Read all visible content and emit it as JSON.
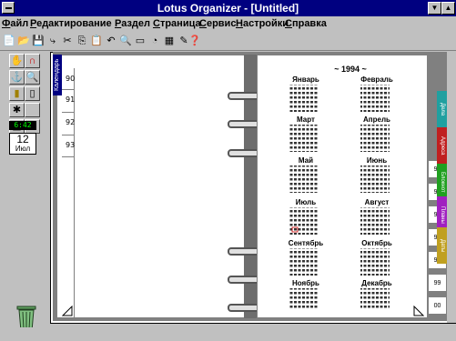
{
  "window": {
    "title": "Lotus Organizer - [Untitled]"
  },
  "menu": {
    "items": [
      "Файл",
      "Редактирование",
      "Раздел",
      "Страница",
      "Сервис",
      "Настройки",
      "Справка"
    ]
  },
  "left_page": {
    "tab_label": "Календарь",
    "days": [
      "90",
      "91",
      "92",
      "93"
    ]
  },
  "calendar_widget": {
    "clock": "6:42",
    "day": "12",
    "month": "Июл"
  },
  "right_page": {
    "year_title": "~ 1994 ~",
    "months": [
      "Январь",
      "Февраль",
      "Март",
      "Апрель",
      "Май",
      "Июнь",
      "Июль",
      "Август",
      "Сентябрь",
      "Октябрь",
      "Ноябрь",
      "Декабрь"
    ],
    "day_tabs": [
      "94",
      "95",
      "96",
      "97",
      "98",
      "99",
      "00"
    ],
    "section_tabs": [
      "Дела",
      "Адреса",
      "Блокнот",
      "Планы",
      "Даты"
    ]
  },
  "colors": {
    "titlebar": "#000080",
    "tab_dela": "#20a0a0",
    "tab_adresa": "#c02020",
    "tab_bloknot": "#20a020",
    "tab_plany": "#a020c0",
    "tab_daty": "#c0a020",
    "calendar_tab": "#000080"
  }
}
